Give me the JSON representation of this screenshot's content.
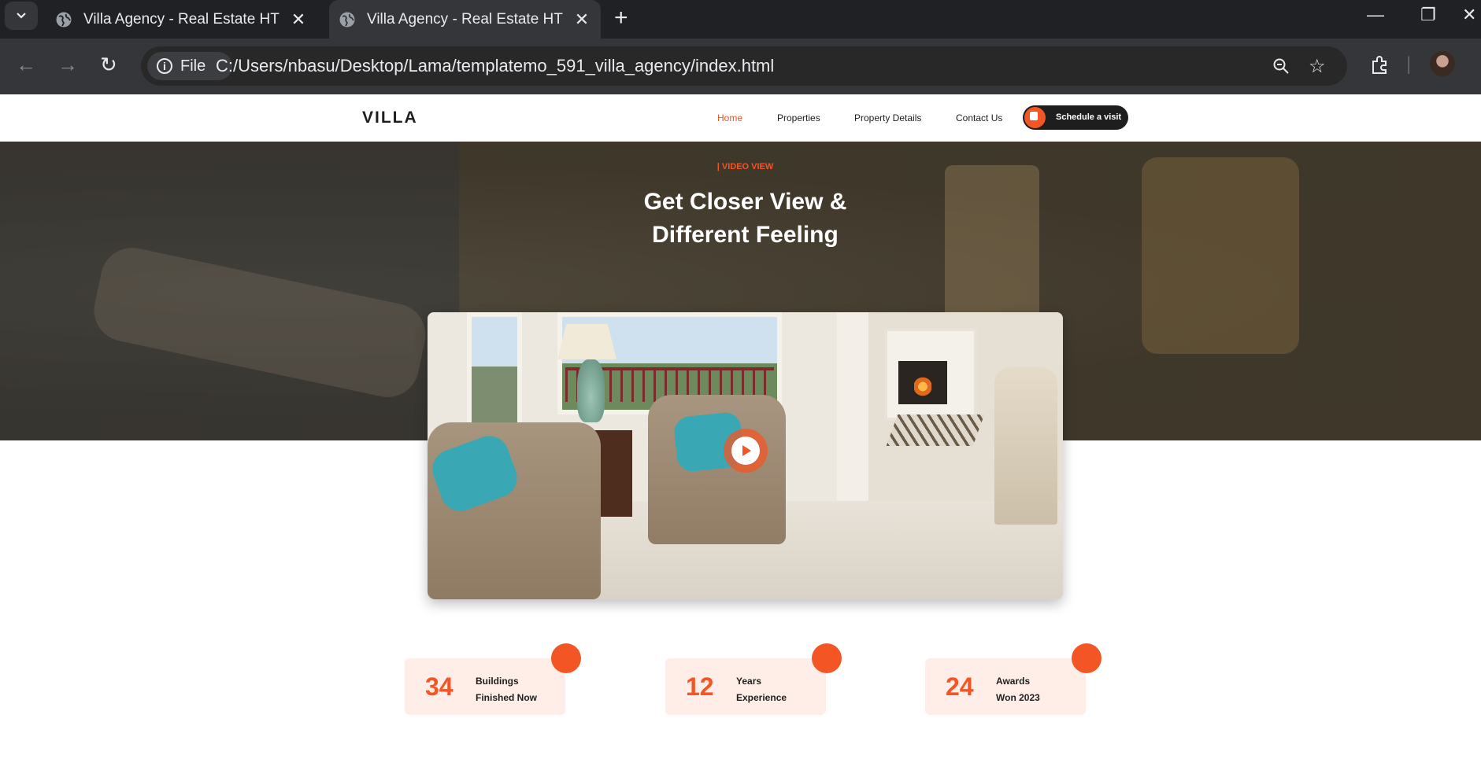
{
  "browser": {
    "tabs": [
      {
        "title": "Villa Agency - Real Estate HTML Template"
      },
      {
        "title": "Villa Agency - Real Estate HTML Template"
      }
    ],
    "new_tab": "+",
    "chip_label": "File",
    "url": "C:/Users/nbasu/Desktop/Lama/templatemo_591_villa_agency/index.html"
  },
  "site": {
    "logo": "VILLA",
    "nav": [
      {
        "label": "Home"
      },
      {
        "label": "Properties"
      },
      {
        "label": "Property Details"
      },
      {
        "label": "Contact Us"
      }
    ],
    "cta": "Schedule a visit"
  },
  "hero": {
    "eyebrow": "| VIDEO VIEW",
    "headline_line1": "Get Closer View &",
    "headline_line2": "Different Feeling"
  },
  "counters": [
    {
      "number": "34",
      "line1": "Buildings",
      "line2": "Finished Now"
    },
    {
      "number": "12",
      "line1": "Years",
      "line2": "Experience"
    },
    {
      "number": "24",
      "line1": "Awards",
      "line2": "Won 2023"
    }
  ],
  "colors": {
    "accent": "#f35525",
    "dark": "#1e1e1e",
    "counter_bg": "#ffeee8"
  }
}
